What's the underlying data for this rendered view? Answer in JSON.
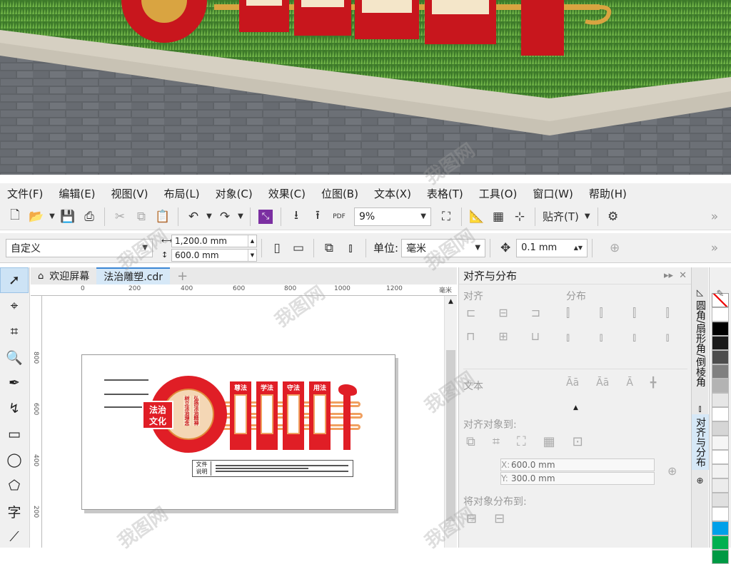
{
  "menu": [
    "文件(F)",
    "编辑(E)",
    "视图(V)",
    "布局(L)",
    "对象(C)",
    "效果(C)",
    "位图(B)",
    "文本(X)",
    "表格(T)",
    "工具(O)",
    "窗口(W)",
    "帮助(H)"
  ],
  "toolbar": {
    "zoom": "9%",
    "snap_label": "贴齐(T)",
    "pdf_label": "PDF",
    "more": "»"
  },
  "property_bar": {
    "preset": "自定义",
    "width": "1,200.0 mm",
    "height": "600.0 mm",
    "unit_label": "单位:",
    "unit_value": "毫米",
    "nudge": "0.1 mm"
  },
  "doc_tabs": [
    {
      "label": "欢迎屏幕",
      "active": false
    },
    {
      "label": "法治雕塑.cdr",
      "active": true
    }
  ],
  "ruler": {
    "h_ticks": [
      "0",
      "200",
      "400",
      "600",
      "800",
      "1000",
      "1200",
      "毫米"
    ],
    "v_ticks": [
      "800",
      "600",
      "400",
      "200",
      "0"
    ]
  },
  "artwork": {
    "title_line1": "法治",
    "title_line2": "文化",
    "vertical_text_1": "树立法治理念",
    "vertical_text_2": "弘扬法治精神",
    "panels": [
      "尊法",
      "学法",
      "守法",
      "用法"
    ],
    "note_label_1": "文件",
    "note_label_2": "说明"
  },
  "docker": {
    "title": "对齐与分布",
    "align_section": "对齐",
    "distribute_section": "分布",
    "text_section": "文本",
    "align_to_section": "对齐对象到:",
    "x_label": "X:",
    "x_value": "600.0 mm",
    "y_label": "Y:",
    "y_value": "300.0 mm",
    "distribute_to_section": "将对象分布到:"
  },
  "side_tabs": [
    "圆角/扇形角/倒棱角",
    "对齐与分布"
  ],
  "palette_colors": [
    "#ffffff",
    "#000000",
    "#1a1a1a",
    "#4d4d4d",
    "#808080",
    "#b3b3b3",
    "#e6e6e6",
    "#ffffff",
    "#d6d6d6",
    "#f5f5f5",
    "#ffffff",
    "#f2f2f2",
    "#ececec",
    "#e0e0e0",
    "#ffffff",
    "#00a0e9",
    "#00b050",
    "#009944"
  ],
  "watermark": "我图网"
}
